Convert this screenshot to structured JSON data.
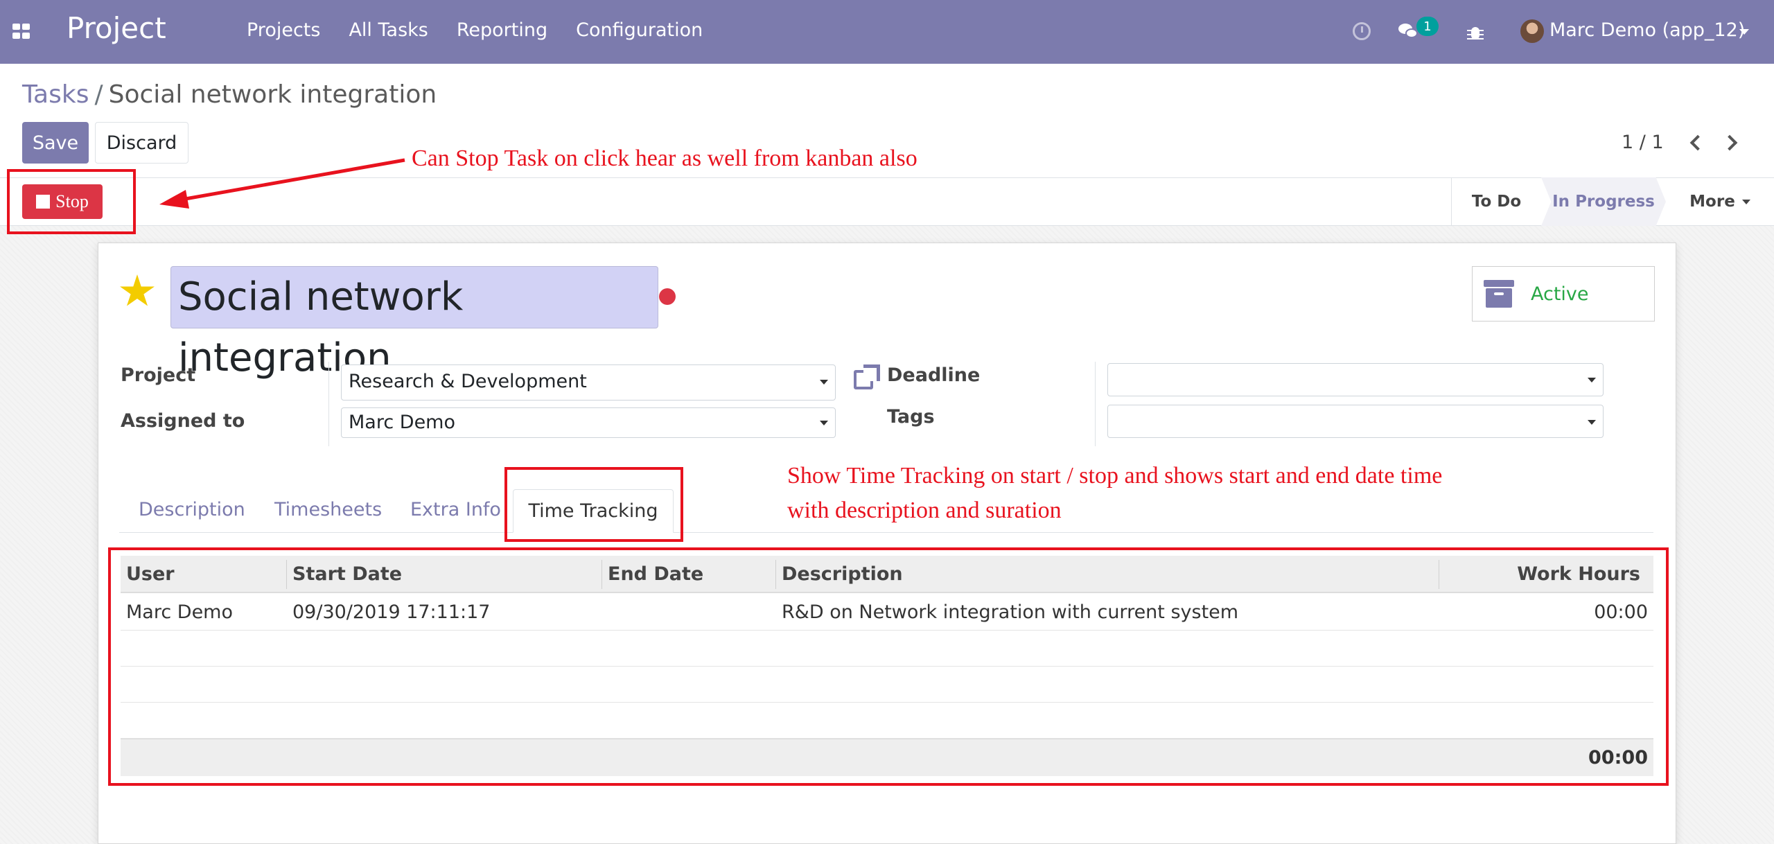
{
  "navbar": {
    "brand": "Project",
    "menu": [
      "Projects",
      "All Tasks",
      "Reporting",
      "Configuration"
    ],
    "chat_count": "1",
    "user": "Marc Demo (app_12)",
    "colors": {
      "bar": "#7c7bad",
      "badge": "#00a09d"
    }
  },
  "breadcrumb": {
    "parent": "Tasks",
    "separator": "/",
    "current": "Social network integration"
  },
  "buttons": {
    "save": "Save",
    "discard": "Discard",
    "stop": "Stop"
  },
  "pager": {
    "value": "1 / 1"
  },
  "stages": {
    "todo": "To Do",
    "in_progress": "In Progress",
    "more": "More"
  },
  "task": {
    "title": "Social network integration",
    "active_label": "Active",
    "starred": true,
    "kanban_state_color": "#dc3545"
  },
  "fields": {
    "project_label": "Project",
    "project_value": "Research & Development",
    "assigned_label": "Assigned to",
    "assigned_value": "Marc Demo",
    "deadline_label": "Deadline",
    "deadline_value": "",
    "tags_label": "Tags",
    "tags_value": ""
  },
  "tabs": [
    "Description",
    "Timesheets",
    "Extra Info",
    "Time Tracking"
  ],
  "active_tab": "Time Tracking",
  "table": {
    "columns": [
      "User",
      "Start Date",
      "End Date",
      "Description",
      "Work Hours"
    ],
    "rows": [
      {
        "user": "Marc Demo",
        "start": "09/30/2019 17:11:17",
        "end": "",
        "description": "R&D on Network integration with current system",
        "hours": "00:00"
      }
    ],
    "total": "00:00"
  },
  "annotations": {
    "stop_note": "Can Stop Task on click hear as well from kanban also",
    "tracking_note_line1": "Show Time Tracking on start / stop and shows start and end date time",
    "tracking_note_line2": "with description and suration",
    "color": "#e8121e"
  }
}
